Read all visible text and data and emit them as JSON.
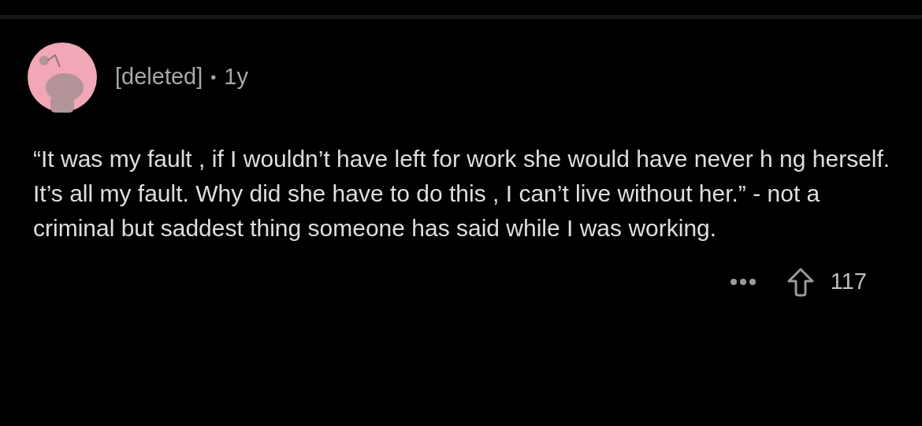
{
  "comment": {
    "author": "[deleted]",
    "separator": "•",
    "age": "1y",
    "body": "“It was my fault , if I wouldn’t have left for work she would have never h  ng herself. It’s all my fault. Why did she have to do this , I can’t live without her.” - not a criminal but saddest thing someone has said while I was working.",
    "score": "117"
  }
}
